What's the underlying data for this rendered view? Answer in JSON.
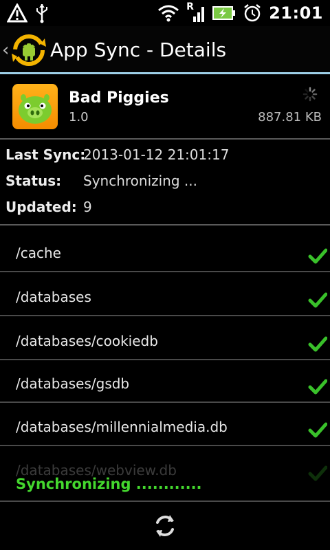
{
  "statusbar": {
    "time": "21:01",
    "roaming_label": "R"
  },
  "header": {
    "title": "App Sync - Details",
    "accent_color": "#9ed0e8"
  },
  "app": {
    "name": "Bad Piggies",
    "version": "1.0",
    "size": "887.81 KB"
  },
  "details": {
    "last_sync_label": "Last Sync:",
    "last_sync_value": "2013-01-12 21:01:17",
    "status_label": "Status:",
    "status_value": "Synchronizing ...",
    "updated_label": "Updated:",
    "updated_value": "9"
  },
  "files": [
    {
      "path": "/cache",
      "synced": true
    },
    {
      "path": "/databases",
      "synced": true
    },
    {
      "path": "/databases/cookiedb",
      "synced": true
    },
    {
      "path": "/databases/gsdb",
      "synced": true
    },
    {
      "path": "/databases/millennialmedia.db",
      "synced": true
    },
    {
      "path": "/databases/webview.db",
      "synced": true
    }
  ],
  "footer": {
    "sync_status": "Synchronizing ............",
    "status_color": "#44d82e"
  }
}
